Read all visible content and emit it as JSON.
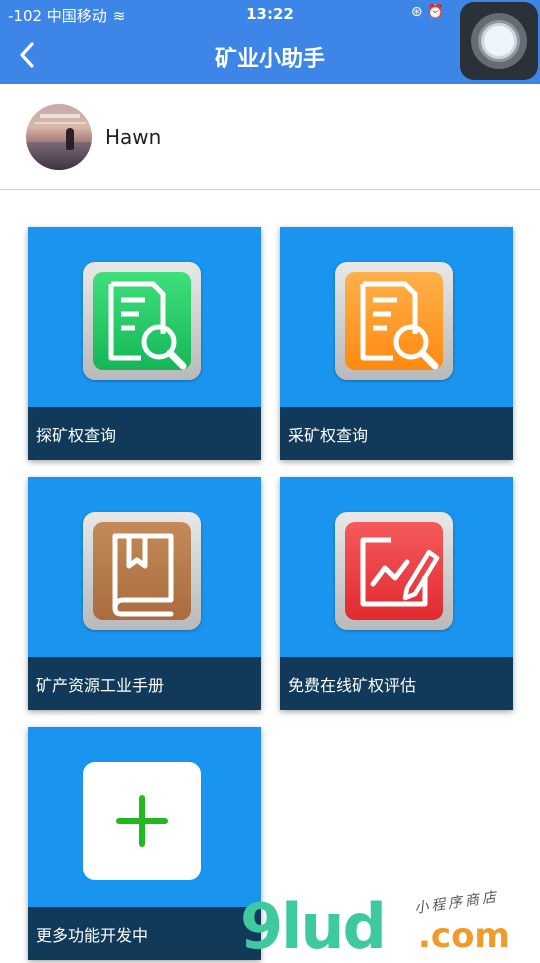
{
  "status_bar": {
    "carrier": "-102 中国移动",
    "time": "13:22"
  },
  "nav": {
    "title": "矿业小助手"
  },
  "profile": {
    "username": "Hawn"
  },
  "tiles": [
    {
      "label": "探矿权查询",
      "icon": "search-document-icon",
      "color": "#22c55e"
    },
    {
      "label": "采矿权查询",
      "icon": "search-document-icon",
      "color": "#ff9a1f"
    },
    {
      "label": "矿产资源工业手册",
      "icon": "book-icon",
      "color": "#b87a4b"
    },
    {
      "label": "免费在线矿权评估",
      "icon": "edit-chart-icon",
      "color": "#ee3b3f"
    },
    {
      "label": "更多功能开发中",
      "icon": "plus-icon",
      "color": "#22b822"
    }
  ],
  "watermark": {
    "brand": "9lud",
    "domain": ".com",
    "tagline": "小程序商店"
  }
}
